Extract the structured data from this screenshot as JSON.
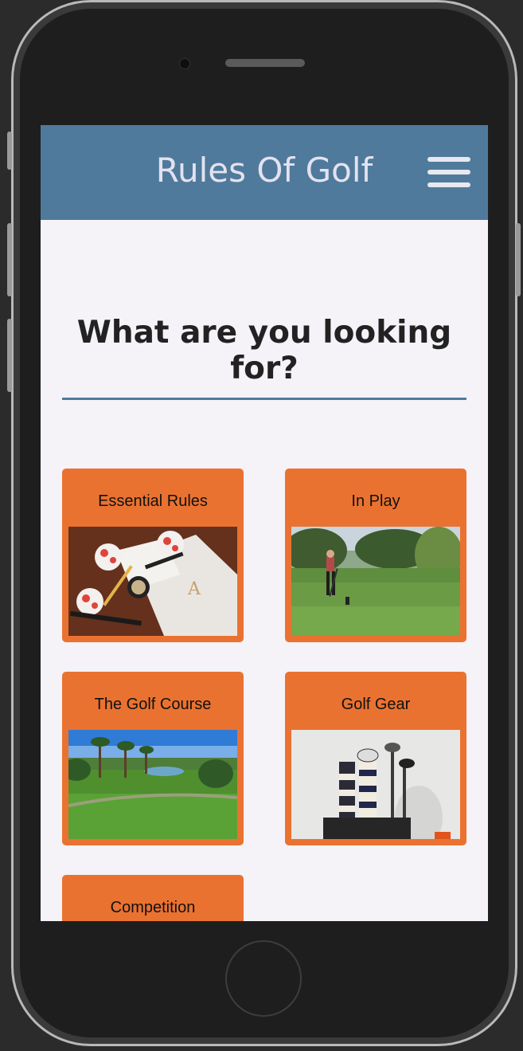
{
  "app": {
    "title": "Rules Of Golf"
  },
  "main": {
    "heading": "What are you looking for?"
  },
  "categories": [
    {
      "label": "Essential Rules",
      "image": "golf-essentials-photo"
    },
    {
      "label": "In Play",
      "image": "golfer-teeing-off-photo"
    },
    {
      "label": "The Golf Course",
      "image": "golf-course-photo"
    },
    {
      "label": "Golf Gear",
      "image": "golf-bag-clubs-photo"
    },
    {
      "label": "Competition",
      "image": "competition-photo"
    }
  ],
  "colors": {
    "navbar": "#4f7a9c",
    "card": "#ea7231",
    "background": "#f5f2f8",
    "divider": "#4f7a9c"
  },
  "icons": {
    "menu": "hamburger-menu-icon"
  }
}
